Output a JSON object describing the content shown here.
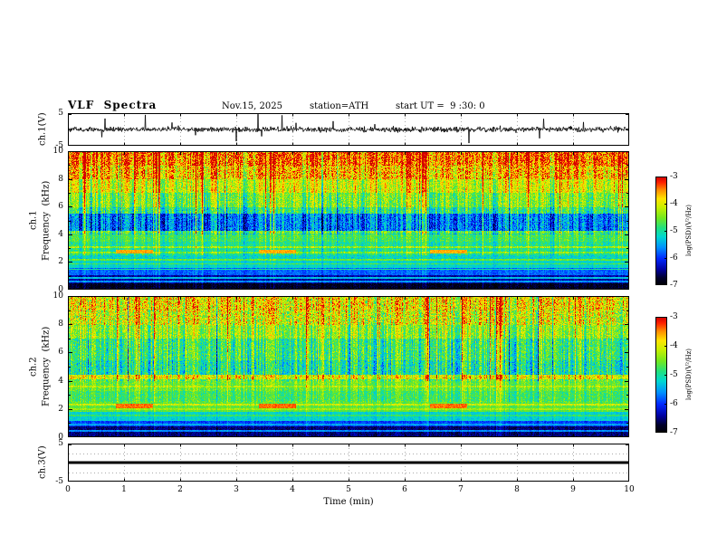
{
  "header": {
    "title": "VLF  Spectra",
    "date": "Nov.15, 2025",
    "station": "station=ATH",
    "start_ut": "start UT =  9 :30: 0"
  },
  "x_axis": {
    "label": "Time  (min)",
    "ticks": [
      0,
      1,
      2,
      3,
      4,
      5,
      6,
      7,
      8,
      9,
      10
    ]
  },
  "panels": {
    "wave1": {
      "label": "ch.1(V)",
      "yticks": [
        5,
        -5
      ]
    },
    "spec1": {
      "channel": "ch.1",
      "ylabel": "Frequency  (kHz)",
      "yticks": [
        10,
        8,
        6,
        4,
        2,
        0
      ]
    },
    "spec2": {
      "channel": "ch.2",
      "ylabel": "Frequency  (kHz)",
      "yticks": [
        10,
        8,
        6,
        4,
        2,
        0
      ]
    },
    "wave3": {
      "label": "ch.3(V)",
      "yticks": [
        5,
        -5
      ]
    }
  },
  "colorbar": {
    "label": "log(PSD)(V²/Hz)",
    "ticks": [
      -3,
      -4,
      -5,
      -6,
      -7
    ]
  },
  "colormap_stops": [
    [
      0,
      "#000000"
    ],
    [
      0.07,
      "#00002a"
    ],
    [
      0.15,
      "#0000a0"
    ],
    [
      0.25,
      "#0028ff"
    ],
    [
      0.35,
      "#0090ff"
    ],
    [
      0.45,
      "#00d8d0"
    ],
    [
      0.53,
      "#20e080"
    ],
    [
      0.62,
      "#70e820"
    ],
    [
      0.72,
      "#c8f000"
    ],
    [
      0.8,
      "#ffe400"
    ],
    [
      0.88,
      "#ff8c00"
    ],
    [
      0.95,
      "#ff2000"
    ],
    [
      1,
      "#d00000"
    ]
  ],
  "chart_data": [
    {
      "type": "line",
      "name": "ch1_waveform",
      "ylabel": "ch.1(V)",
      "y_range": [
        -5,
        5
      ],
      "x_range_min": [
        0,
        10
      ],
      "signal": "broadband noise ~±1 V with random impulsive spikes reaching ±5 V"
    },
    {
      "type": "heatmap",
      "name": "ch1_spectrogram",
      "channel": "ch.1",
      "ylabel": "Frequency (kHz)",
      "x_range_min": [
        0,
        10
      ],
      "y_range_khz": [
        0,
        10
      ],
      "value_label": "log(PSD)(V²/Hz)",
      "value_range": [
        -7,
        -3
      ],
      "streak_bias": 0.42,
      "streak_amp": 1.0,
      "bands": [
        [
          9,
          10.01,
          -3.5
        ],
        [
          8,
          9,
          -3.8
        ],
        [
          7,
          8,
          -4.2
        ],
        [
          6,
          7,
          -4.6
        ],
        [
          5.5,
          6,
          -5.0
        ],
        [
          4.3,
          5.5,
          -5.8
        ],
        [
          3.5,
          4.3,
          -4.8
        ],
        [
          2.5,
          3.5,
          -5.0
        ],
        [
          1.6,
          2.5,
          -5.2
        ],
        [
          1.1,
          1.6,
          -5.8
        ],
        [
          0.5,
          1.1,
          -6.4
        ],
        [
          0,
          0.5,
          -6.8
        ]
      ],
      "lines": [
        [
          4.05,
          -5.2
        ],
        [
          3.1,
          -4.4
        ],
        [
          2.7,
          -4.5
        ],
        [
          2.2,
          -4.6
        ],
        [
          1.9,
          -4.7
        ],
        [
          1.5,
          -5.0
        ],
        [
          0.9,
          -5.4
        ],
        [
          0.6,
          -5.6
        ]
      ],
      "burst": {
        "f_lo": 2.65,
        "f_hi": 2.9,
        "level": -3.6,
        "t_ranges": [
          [
            0.85,
            1.5
          ],
          [
            3.4,
            4.05
          ],
          [
            6.45,
            7.1
          ]
        ]
      }
    },
    {
      "type": "heatmap",
      "name": "ch2_spectrogram",
      "channel": "ch.2",
      "ylabel": "Frequency (kHz)",
      "x_range_min": [
        0,
        10
      ],
      "y_range_khz": [
        0,
        10
      ],
      "value_label": "log(PSD)(V²/Hz)",
      "value_range": [
        -7,
        -3
      ],
      "streak_bias": 0.56,
      "streak_amp": 1.1,
      "bands": [
        [
          9,
          10.01,
          -3.8
        ],
        [
          8,
          9,
          -4.0
        ],
        [
          7,
          8,
          -4.3
        ],
        [
          5.5,
          7,
          -4.7
        ],
        [
          4.45,
          5.5,
          -4.9
        ],
        [
          4.15,
          4.45,
          -3.9
        ],
        [
          3.3,
          4.15,
          -4.5
        ],
        [
          2.6,
          3.3,
          -4.7
        ],
        [
          1.8,
          2.6,
          -4.6
        ],
        [
          1.2,
          1.8,
          -5.2
        ],
        [
          0.8,
          1.2,
          -5.9
        ],
        [
          0,
          0.8,
          -6.5
        ]
      ],
      "lines": [
        [
          3.6,
          -4.2
        ],
        [
          2.35,
          -4.1
        ],
        [
          2.0,
          -4.3
        ],
        [
          1.55,
          -4.8
        ],
        [
          0.95,
          -5.5
        ],
        [
          0.5,
          -5.6
        ]
      ],
      "burst": {
        "f_lo": 2.1,
        "f_hi": 2.4,
        "level": -3.4,
        "t_ranges": [
          [
            0.85,
            1.5
          ],
          [
            3.4,
            4.05
          ],
          [
            6.45,
            7.1
          ]
        ]
      }
    },
    {
      "type": "line",
      "name": "ch3_waveform",
      "ylabel": "ch.3(V)",
      "y_range": [
        -5,
        5
      ],
      "x_range_min": [
        0,
        10
      ],
      "signal": "constant 0 V (flat thick line)"
    }
  ]
}
